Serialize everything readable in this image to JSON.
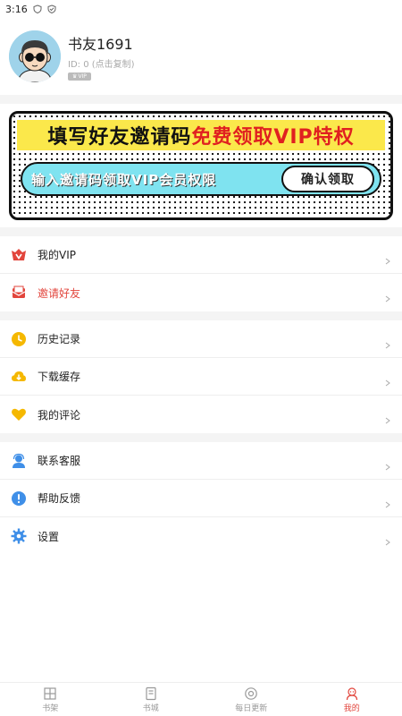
{
  "status": {
    "time": "3:16"
  },
  "profile": {
    "name": "书友1691",
    "id_text": "ID: 0 (点击复制)",
    "vip_badge": "VIP"
  },
  "banner": {
    "title_part1": "填写好友邀请码",
    "title_part2": "免费领取VIP特权",
    "input_text": "输入邀请码领取VIP会员权限",
    "confirm_button": "确认领取"
  },
  "menu": {
    "group1": [
      {
        "label": "我的VIP",
        "icon": "vip-crown-icon"
      },
      {
        "label": "邀请好友",
        "icon": "invite-envelope-icon"
      }
    ],
    "group2": [
      {
        "label": "历史记录",
        "icon": "clock-icon"
      },
      {
        "label": "下载缓存",
        "icon": "download-cloud-icon"
      },
      {
        "label": "我的评论",
        "icon": "heart-icon"
      }
    ],
    "group3": [
      {
        "label": "联系客服",
        "icon": "customer-service-icon"
      },
      {
        "label": "帮助反馈",
        "icon": "exclamation-icon"
      },
      {
        "label": "设置",
        "icon": "gear-icon"
      }
    ]
  },
  "nav": {
    "items": [
      {
        "label": "书架",
        "icon": "bookshelf-icon"
      },
      {
        "label": "书城",
        "icon": "bookstore-icon"
      },
      {
        "label": "每日更新",
        "icon": "daily-update-icon"
      },
      {
        "label": "我的",
        "icon": "profile-icon"
      }
    ],
    "active": "我的"
  },
  "colors": {
    "accent": "#e2453c",
    "vip_red": "#e2453c",
    "clock_yellow": "#f5b800",
    "service_blue": "#3f8fe8",
    "banner_yellow": "#fbe84b",
    "banner_cyan": "#7fe3f0"
  }
}
